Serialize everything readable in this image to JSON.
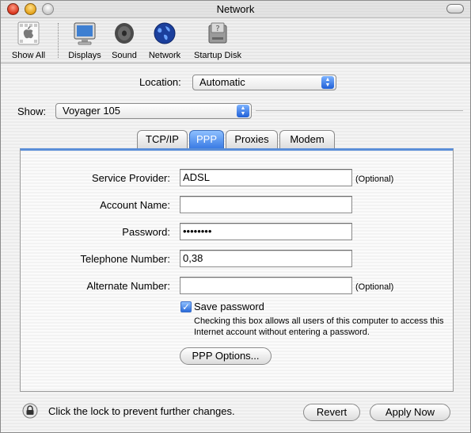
{
  "window": {
    "title": "Network"
  },
  "toolbar": {
    "items": [
      {
        "label": "Show All",
        "icon": "apple-icon"
      },
      {
        "label": "Displays",
        "icon": "display-icon"
      },
      {
        "label": "Sound",
        "icon": "speaker-icon"
      },
      {
        "label": "Network",
        "icon": "globe-icon"
      },
      {
        "label": "Startup Disk",
        "icon": "disk-icon"
      }
    ]
  },
  "location": {
    "label": "Location:",
    "value": "Automatic"
  },
  "show": {
    "label": "Show:",
    "value": "Voyager 105"
  },
  "tabs": [
    {
      "label": "TCP/IP",
      "active": false
    },
    {
      "label": "PPP",
      "active": true
    },
    {
      "label": "Proxies",
      "active": false
    },
    {
      "label": "Modem",
      "active": false
    }
  ],
  "ppp": {
    "service_provider": {
      "label": "Service Provider:",
      "value": "ADSL",
      "note": "(Optional)"
    },
    "account_name": {
      "label": "Account Name:",
      "value": ""
    },
    "password": {
      "label": "Password:",
      "value": "••••••••"
    },
    "telephone": {
      "label": "Telephone Number:",
      "value": "0,38"
    },
    "alternate": {
      "label": "Alternate Number:",
      "value": "",
      "note": "(Optional)"
    },
    "save_password": {
      "label": "Save password",
      "checked": true,
      "help": "Checking this box allows all users of this computer to access this Internet account without entering a password."
    },
    "options_button": "PPP Options..."
  },
  "footer": {
    "lock_text": "Click the lock to prevent further changes.",
    "revert": "Revert",
    "apply": "Apply Now"
  },
  "colors": {
    "accent": "#3a7be4",
    "panel_top": "#5a8ed8"
  }
}
